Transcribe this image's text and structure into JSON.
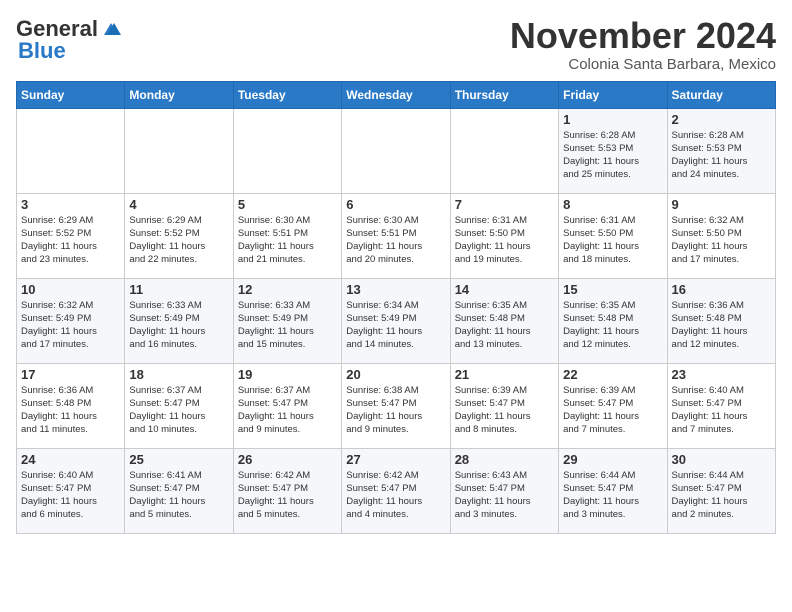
{
  "header": {
    "logo_general": "General",
    "logo_blue": "Blue",
    "month": "November 2024",
    "location": "Colonia Santa Barbara, Mexico"
  },
  "days_of_week": [
    "Sunday",
    "Monday",
    "Tuesday",
    "Wednesday",
    "Thursday",
    "Friday",
    "Saturday"
  ],
  "weeks": [
    [
      {
        "day": "",
        "info": ""
      },
      {
        "day": "",
        "info": ""
      },
      {
        "day": "",
        "info": ""
      },
      {
        "day": "",
        "info": ""
      },
      {
        "day": "",
        "info": ""
      },
      {
        "day": "1",
        "info": "Sunrise: 6:28 AM\nSunset: 5:53 PM\nDaylight: 11 hours\nand 25 minutes."
      },
      {
        "day": "2",
        "info": "Sunrise: 6:28 AM\nSunset: 5:53 PM\nDaylight: 11 hours\nand 24 minutes."
      }
    ],
    [
      {
        "day": "3",
        "info": "Sunrise: 6:29 AM\nSunset: 5:52 PM\nDaylight: 11 hours\nand 23 minutes."
      },
      {
        "day": "4",
        "info": "Sunrise: 6:29 AM\nSunset: 5:52 PM\nDaylight: 11 hours\nand 22 minutes."
      },
      {
        "day": "5",
        "info": "Sunrise: 6:30 AM\nSunset: 5:51 PM\nDaylight: 11 hours\nand 21 minutes."
      },
      {
        "day": "6",
        "info": "Sunrise: 6:30 AM\nSunset: 5:51 PM\nDaylight: 11 hours\nand 20 minutes."
      },
      {
        "day": "7",
        "info": "Sunrise: 6:31 AM\nSunset: 5:50 PM\nDaylight: 11 hours\nand 19 minutes."
      },
      {
        "day": "8",
        "info": "Sunrise: 6:31 AM\nSunset: 5:50 PM\nDaylight: 11 hours\nand 18 minutes."
      },
      {
        "day": "9",
        "info": "Sunrise: 6:32 AM\nSunset: 5:50 PM\nDaylight: 11 hours\nand 17 minutes."
      }
    ],
    [
      {
        "day": "10",
        "info": "Sunrise: 6:32 AM\nSunset: 5:49 PM\nDaylight: 11 hours\nand 17 minutes."
      },
      {
        "day": "11",
        "info": "Sunrise: 6:33 AM\nSunset: 5:49 PM\nDaylight: 11 hours\nand 16 minutes."
      },
      {
        "day": "12",
        "info": "Sunrise: 6:33 AM\nSunset: 5:49 PM\nDaylight: 11 hours\nand 15 minutes."
      },
      {
        "day": "13",
        "info": "Sunrise: 6:34 AM\nSunset: 5:49 PM\nDaylight: 11 hours\nand 14 minutes."
      },
      {
        "day": "14",
        "info": "Sunrise: 6:35 AM\nSunset: 5:48 PM\nDaylight: 11 hours\nand 13 minutes."
      },
      {
        "day": "15",
        "info": "Sunrise: 6:35 AM\nSunset: 5:48 PM\nDaylight: 11 hours\nand 12 minutes."
      },
      {
        "day": "16",
        "info": "Sunrise: 6:36 AM\nSunset: 5:48 PM\nDaylight: 11 hours\nand 12 minutes."
      }
    ],
    [
      {
        "day": "17",
        "info": "Sunrise: 6:36 AM\nSunset: 5:48 PM\nDaylight: 11 hours\nand 11 minutes."
      },
      {
        "day": "18",
        "info": "Sunrise: 6:37 AM\nSunset: 5:47 PM\nDaylight: 11 hours\nand 10 minutes."
      },
      {
        "day": "19",
        "info": "Sunrise: 6:37 AM\nSunset: 5:47 PM\nDaylight: 11 hours\nand 9 minutes."
      },
      {
        "day": "20",
        "info": "Sunrise: 6:38 AM\nSunset: 5:47 PM\nDaylight: 11 hours\nand 9 minutes."
      },
      {
        "day": "21",
        "info": "Sunrise: 6:39 AM\nSunset: 5:47 PM\nDaylight: 11 hours\nand 8 minutes."
      },
      {
        "day": "22",
        "info": "Sunrise: 6:39 AM\nSunset: 5:47 PM\nDaylight: 11 hours\nand 7 minutes."
      },
      {
        "day": "23",
        "info": "Sunrise: 6:40 AM\nSunset: 5:47 PM\nDaylight: 11 hours\nand 7 minutes."
      }
    ],
    [
      {
        "day": "24",
        "info": "Sunrise: 6:40 AM\nSunset: 5:47 PM\nDaylight: 11 hours\nand 6 minutes."
      },
      {
        "day": "25",
        "info": "Sunrise: 6:41 AM\nSunset: 5:47 PM\nDaylight: 11 hours\nand 5 minutes."
      },
      {
        "day": "26",
        "info": "Sunrise: 6:42 AM\nSunset: 5:47 PM\nDaylight: 11 hours\nand 5 minutes."
      },
      {
        "day": "27",
        "info": "Sunrise: 6:42 AM\nSunset: 5:47 PM\nDaylight: 11 hours\nand 4 minutes."
      },
      {
        "day": "28",
        "info": "Sunrise: 6:43 AM\nSunset: 5:47 PM\nDaylight: 11 hours\nand 3 minutes."
      },
      {
        "day": "29",
        "info": "Sunrise: 6:44 AM\nSunset: 5:47 PM\nDaylight: 11 hours\nand 3 minutes."
      },
      {
        "day": "30",
        "info": "Sunrise: 6:44 AM\nSunset: 5:47 PM\nDaylight: 11 hours\nand 2 minutes."
      }
    ]
  ]
}
